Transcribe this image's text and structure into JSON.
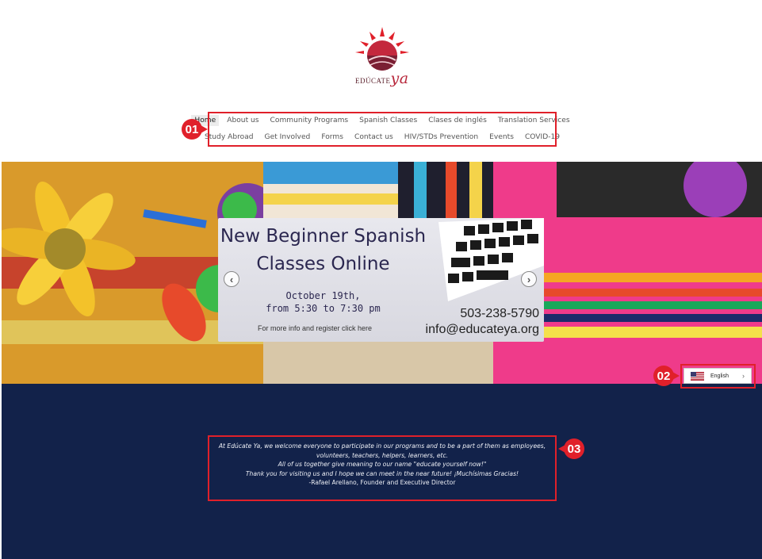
{
  "logo": {
    "word_prefix": "EDÚCATE",
    "word_suffix": "ya"
  },
  "nav": {
    "row1": [
      "Home",
      "About us",
      "Community Programs",
      "Spanish Classes",
      "Clases de inglés",
      "Translation Services"
    ],
    "row2": [
      "Study Abroad",
      "Get Involved",
      "Forms",
      "Contact us",
      "HIV/STDs Prevention",
      "Events",
      "COVID-19"
    ],
    "active": "Home"
  },
  "badges": {
    "b1": "01",
    "b2": "02",
    "b3": "03"
  },
  "hero": {
    "title_line1": "New Beginner Spanish",
    "title_line2": "Classes Online",
    "date_line1": "October 19th,",
    "date_line2": "from 5:30 to 7:30 pm",
    "small": "For more info and register click here",
    "phone": "503-238-5790",
    "email": "info@educateya.org",
    "prev_icon": "chevron-left-icon",
    "next_icon": "chevron-right-icon"
  },
  "language": {
    "label": "English",
    "flag": "us-flag-icon"
  },
  "welcome": {
    "line1": "At Edúcate Ya, we welcome everyone to participate in our programs and to be a part of them as employees,",
    "line2": "volunteers, teachers, helpers, learners, etc.",
    "line3": "All of us together give meaning to our name \"educate yourself now!\"",
    "line4": "Thank you for visiting us and I hope we can meet in the near future! ¡Muchísimas Gracias!",
    "signature": "-Rafael Arellano, Founder and Executive Director"
  },
  "colors": {
    "navy": "#12224a",
    "annotation": "#e0202a",
    "brand": "#b8283c"
  }
}
